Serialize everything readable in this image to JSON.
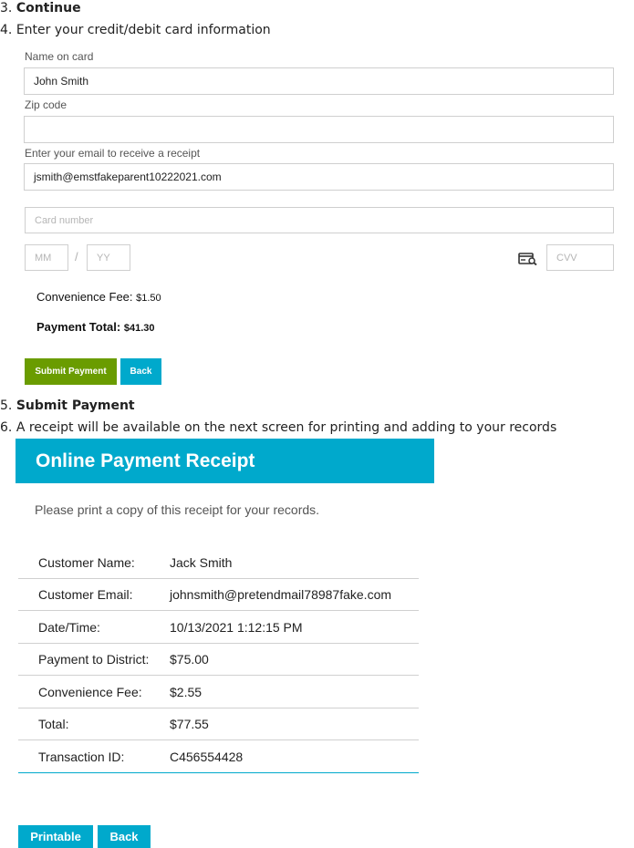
{
  "steps": {
    "s3_num": "3.",
    "s3_text": "Continue",
    "s4_num": "4.",
    "s4_text": "Enter your credit/debit card information",
    "s5_num": "5.",
    "s5_text": "Submit Payment",
    "s6_num": "6.",
    "s6_text": "A receipt will be available on the next screen for printing and adding to your records"
  },
  "form": {
    "name_label": "Name on card",
    "name_value": "John Smith",
    "zip_label": "Zip code",
    "zip_value": "",
    "email_label": "Enter your email to receive a receipt",
    "email_value": "jsmith@emstfakeparent10222021.com",
    "card_placeholder": "Card number",
    "mm_placeholder": "MM",
    "separator": "/",
    "yy_placeholder": "YY",
    "cvv_placeholder": "CVV",
    "cvv_icon": "card-info-icon",
    "fee_label": "Convenience Fee:",
    "fee_value": "$1.50",
    "total_label": "Payment Total:",
    "total_value": "$41.30",
    "submit_label": "Submit Payment",
    "back_label": "Back",
    "submit_color": "#6a9c00",
    "accent_color": "#00a9cc"
  },
  "receipt": {
    "title": "Online Payment Receipt",
    "note": "Please print a copy of this receipt for your records.",
    "rows": [
      {
        "label": "Customer Name:",
        "value": "Jack Smith"
      },
      {
        "label": "Customer Email:",
        "value": "johnsmith@pretendmail78987fake.com"
      },
      {
        "label": "Date/Time:",
        "value": "10/13/2021 1:12:15 PM"
      },
      {
        "label": "Payment to District:",
        "value": "$75.00"
      },
      {
        "label": "Convenience Fee:",
        "value": "$2.55"
      },
      {
        "label": "Total:",
        "value": "$77.55"
      },
      {
        "label": "Transaction ID:",
        "value": "C456554428"
      }
    ],
    "printable_label": "Printable",
    "back_label": "Back"
  }
}
